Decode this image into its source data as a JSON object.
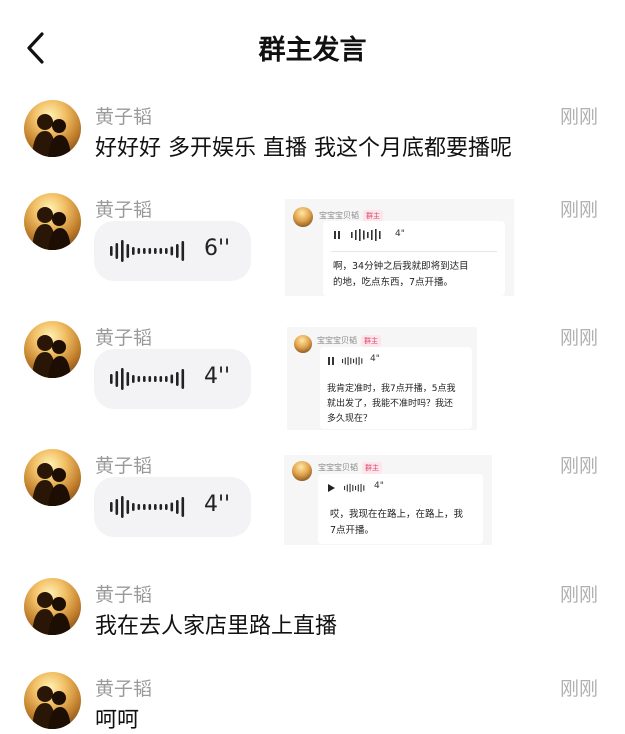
{
  "header": {
    "title": "群主发言",
    "back_icon": "chevron-left-icon"
  },
  "messages": [
    {
      "type": "text",
      "author": "黄子韬",
      "time": "刚刚",
      "text": "好好好 多开娱乐 直播 我这个月底都要播呢"
    },
    {
      "type": "voice",
      "author": "黄子韬",
      "time": "刚刚",
      "duration": "6''",
      "quote": {
        "sender": "宝宝宝贝韬",
        "badge": "群主",
        "duration": "4\"",
        "text_lines": [
          "啊，34分钟之后我就即将到达目",
          "的地，吃点东西，7点开播。"
        ]
      }
    },
    {
      "type": "voice",
      "author": "黄子韬",
      "time": "刚刚",
      "duration": "4''",
      "quote": {
        "sender": "宝宝宝贝韬",
        "badge": "群主",
        "duration": "4\"",
        "text_lines": [
          "我肯定准时，我7点开播，5点我",
          "就出发了，我能不准时吗？我还",
          "多久现在？"
        ]
      }
    },
    {
      "type": "voice",
      "author": "黄子韬",
      "time": "刚刚",
      "duration": "4''",
      "quote": {
        "sender": "宝宝宝贝韬",
        "badge": "群主",
        "duration": "4\"",
        "text_lines": [
          "哎，我现在在路上，在路上，我",
          "7点开播。"
        ]
      }
    },
    {
      "type": "text",
      "author": "黄子韬",
      "time": "刚刚",
      "text": "我在去人家店里路上直播"
    },
    {
      "type": "text",
      "author": "黄子韬",
      "time": "刚刚",
      "text": "呵呵"
    }
  ]
}
